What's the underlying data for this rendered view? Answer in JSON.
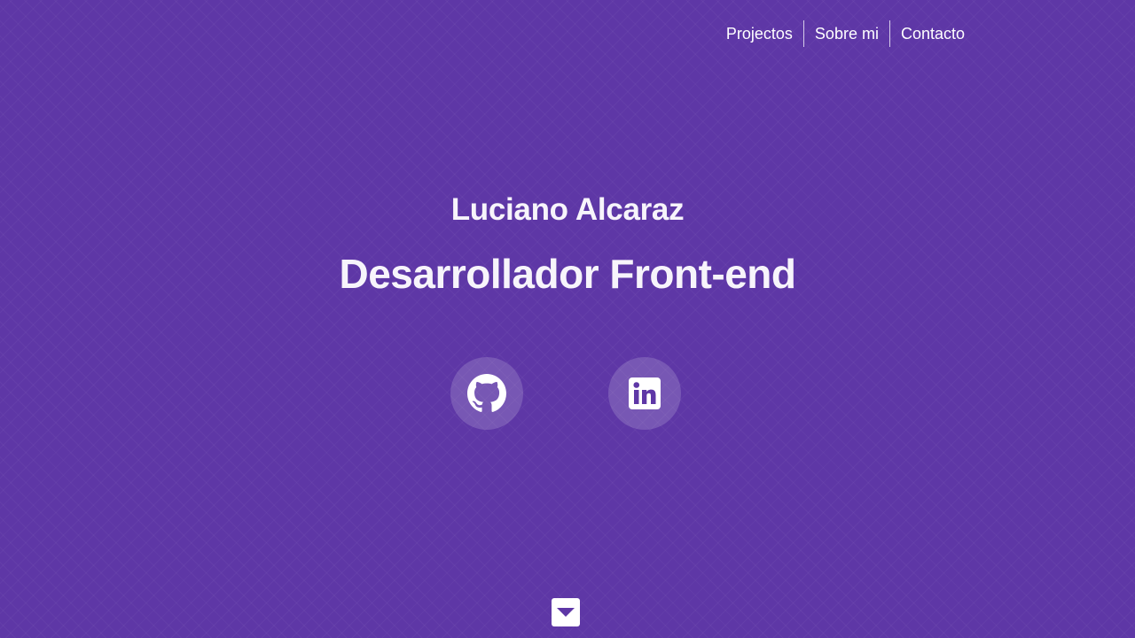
{
  "nav": {
    "items": [
      {
        "label": "Projectos"
      },
      {
        "label": "Sobre mi"
      },
      {
        "label": "Contacto"
      }
    ]
  },
  "hero": {
    "name": "Luciano Alcaraz",
    "title": "Desarrollador Front-end"
  },
  "social": [
    {
      "icon": "github-icon"
    },
    {
      "icon": "linkedin-icon"
    }
  ],
  "scroll": {
    "icon": "caret-down-icon"
  },
  "colors": {
    "background": "#5e37a6",
    "text": "#ffffff",
    "social_circle": "rgba(255,255,255,0.16)",
    "accent_icon": "#5e37a6"
  }
}
